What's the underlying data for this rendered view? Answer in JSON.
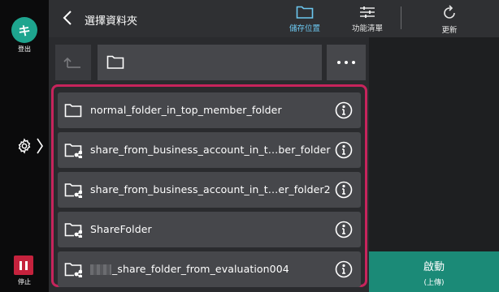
{
  "rail": {
    "logout_glyph": "キ",
    "logout_label": "登出",
    "stop_label": "停止",
    "logout_color": "#1ea58f",
    "stop_color": "#c5223d"
  },
  "header": {
    "title": "選擇資料夾",
    "tools": {
      "save_location": "儲存位置",
      "function_list": "功能清單",
      "refresh": "更新"
    },
    "accent_color": "#6cc7f0"
  },
  "path_bar": {
    "current_path": ""
  },
  "folders": [
    {
      "name": "normal_folder_in_top_member_folder",
      "shared": false,
      "redacted_prefix": false
    },
    {
      "name": "share_from_business_account_in_t…ber_folder",
      "shared": true,
      "redacted_prefix": false
    },
    {
      "name": "share_from_business_account_in_t…er_folder2",
      "shared": true,
      "redacted_prefix": false
    },
    {
      "name": "ShareFolder",
      "shared": true,
      "redacted_prefix": false
    },
    {
      "name": "_share_folder_from_evaluation004",
      "shared": true,
      "redacted_prefix": true
    }
  ],
  "start_button": {
    "label": "啟動",
    "sub_label": "(上傳)",
    "color": "#1b8a77"
  },
  "highlight_color": "#c7245c"
}
